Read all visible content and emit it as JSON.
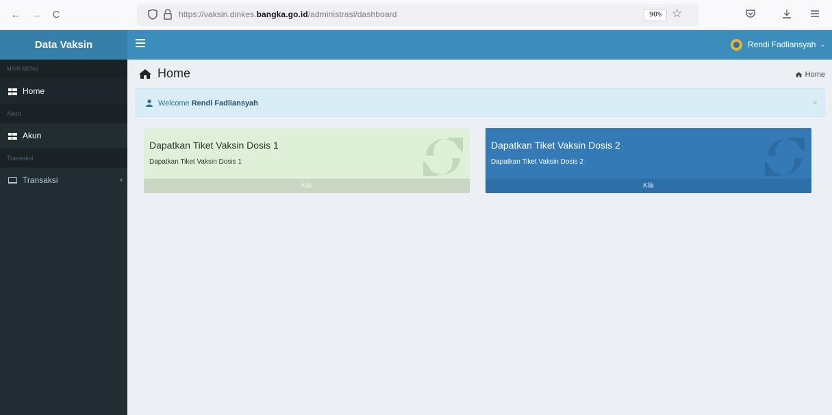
{
  "browser": {
    "back_icon": "←",
    "forward_icon": "→",
    "reload_icon": "C",
    "url_prefix": "https://vaksin.dinkes.",
    "url_domain": "bangka.go.id",
    "url_path": "/administrasi/dashboard",
    "zoom": "90%"
  },
  "app": {
    "logo": "Data Vaksin",
    "user_name": "Rendi Fadliansyah"
  },
  "sidebar": {
    "main_header": "MAIN MENU",
    "home_label": "Home",
    "akun_header": "Akun",
    "akun_label": "Akun",
    "transaksi_header": "Transaksi",
    "transaksi_label": "Transaksi"
  },
  "page": {
    "title": "Home",
    "breadcrumb": "Home"
  },
  "callout": {
    "prefix": "Welcome ",
    "name": "Rendi Fadliansyah",
    "close": "×"
  },
  "cards": [
    {
      "title": "Dapatkan Tiket Vaksin Dosis 1",
      "subtitle": "Dapatkan Tiket Vaksin Dosis 1",
      "footer": "Klik"
    },
    {
      "title": "Dapatkan Tiket Vaksin Dosis 2",
      "subtitle": "Dapatkan Tiket Vaksin Dosis 2",
      "footer": "Klik"
    }
  ],
  "colors": {
    "header_primary": "#3c8dbc",
    "logo_bg": "#367fa9",
    "sidebar_bg": "#222d32",
    "card1_bg": "#dff0d8",
    "card2_bg": "#337ab7",
    "callout_bg": "#d9edf7"
  },
  "icons": {
    "sidebar_toggle": "bars-icon",
    "home": "home-icon",
    "akun": "grid-icon",
    "transaksi": "laptop-icon",
    "card_icon": "refresh-icon",
    "callout_user": "user-icon"
  }
}
